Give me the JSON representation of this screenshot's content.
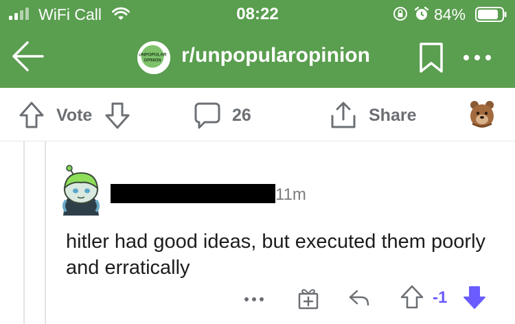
{
  "status_bar": {
    "carrier": "WiFi Call",
    "time": "08:22",
    "battery": "84%"
  },
  "nav": {
    "subreddit": "r/unpopularopinion",
    "subreddit_icon_text": "UNPOPULAR OPINION",
    "icons": [
      "back-arrow-icon",
      "bookmark-icon",
      "more-icon"
    ]
  },
  "actions": {
    "vote_label": "Vote",
    "comment_count": "26",
    "share_label": "Share",
    "icons": [
      "upvote-icon",
      "downvote-icon",
      "comment-icon",
      "share-icon"
    ]
  },
  "comment": {
    "time": "11m",
    "body": "hitler had good ideas, but executed them poorly and erratically",
    "score": "-1",
    "vote_state": "downvoted",
    "icons": [
      "more-icon",
      "gift-icon",
      "reply-icon",
      "upvote-icon",
      "downvote-icon"
    ]
  },
  "colors": {
    "header": "#5a9e4f",
    "text_secondary": "#6b6f73",
    "score_active": "#6a5cff"
  }
}
